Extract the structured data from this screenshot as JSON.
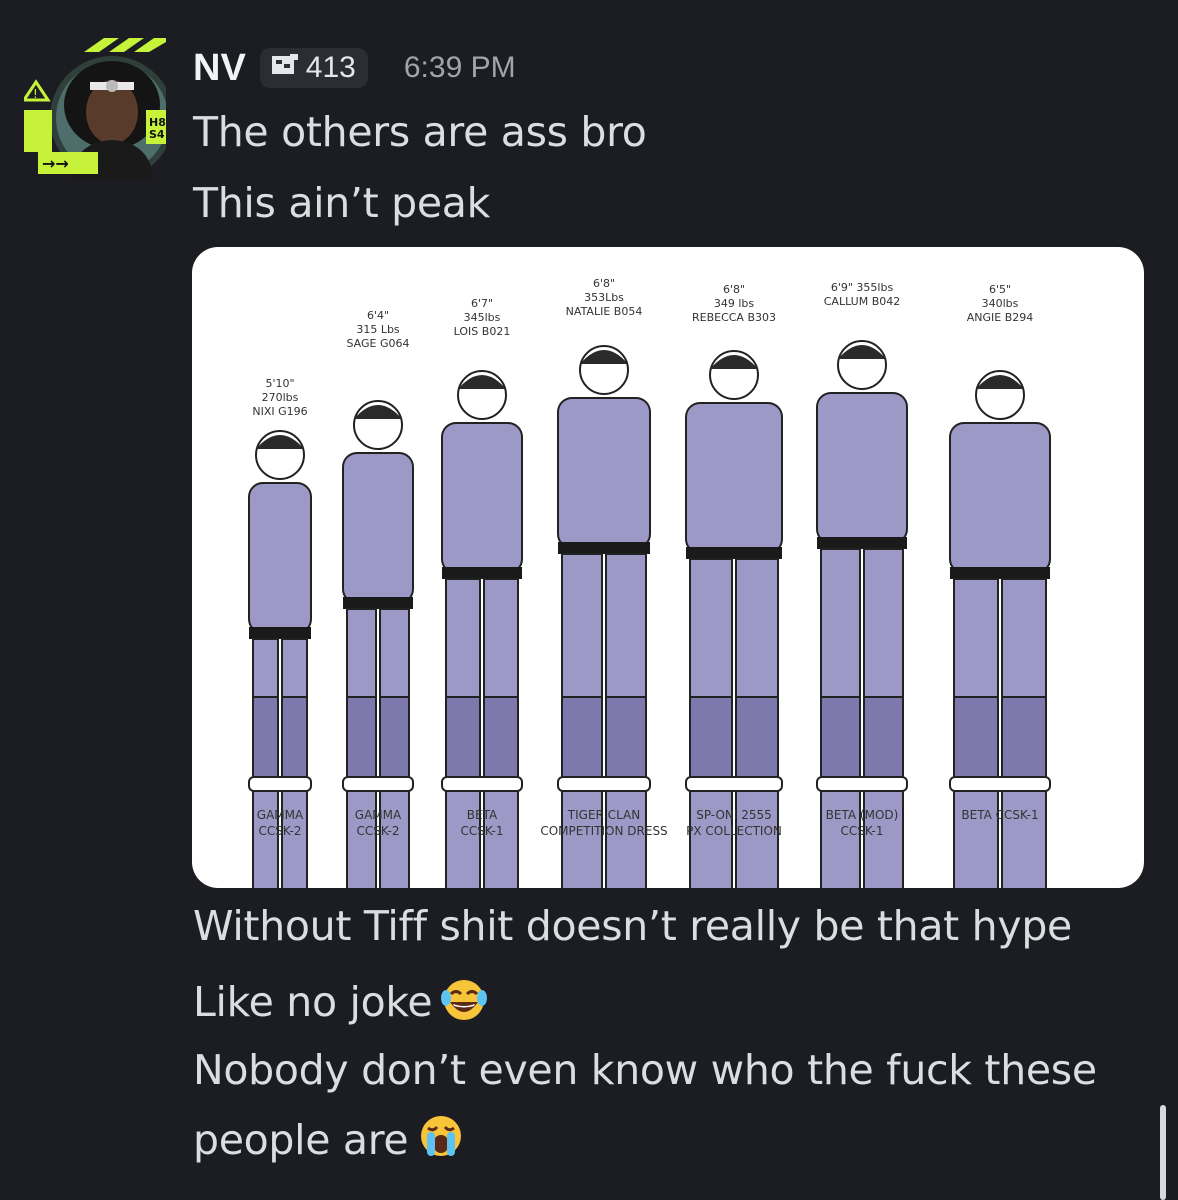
{
  "message": {
    "author": "NV",
    "tag_count": "413",
    "timestamp": "6:39 PM",
    "lines_before": [
      "The others are ass bro",
      "This ain’t peak"
    ],
    "lines_after": [
      "Without Tiff shit doesn’t really be that hype",
      "Like no joke",
      "Nobody don’t even know who the fuck these",
      "people are"
    ],
    "emoji_after_line_2": "joy-emoji",
    "emoji_after_line_4": "sob-emoji"
  },
  "avatar": {
    "badge_text": [
      "H8",
      "S4"
    ],
    "accent_color": "#c6f23a"
  },
  "attachment": {
    "characters": [
      {
        "stats": [
          "5'10\"",
          "270lbs",
          "NIXI G196"
        ],
        "outfit": [
          "GAMMA",
          "CCSK-2"
        ]
      },
      {
        "stats": [
          "6'4\"",
          "315 Lbs",
          "SAGE G064"
        ],
        "outfit": [
          "GAMMA",
          "CCSK-2"
        ]
      },
      {
        "stats": [
          "6'7\"",
          "345lbs",
          "LOIS B021"
        ],
        "outfit": [
          "BETA",
          "CCSK-1"
        ]
      },
      {
        "stats": [
          "6'8\"",
          "353Lbs",
          "NATALIE B054"
        ],
        "outfit": [
          "TIGER CLAN",
          "COMPETITION DRESS"
        ]
      },
      {
        "stats": [
          "6'8\"",
          "349 lbs",
          "REBECCA B303"
        ],
        "outfit": [
          "SP-ONI 2555",
          "PX COLLECTION"
        ]
      },
      {
        "stats": [
          "6'9\" 355lbs",
          "CALLUM B042"
        ],
        "outfit": [
          "BETA (MOD)",
          "CCSK-1"
        ]
      },
      {
        "stats": [
          "6'5\"",
          "340lbs",
          "ANGIE B294"
        ],
        "outfit": [
          "BETA CCSK-1"
        ]
      }
    ],
    "uniform_color": "#9d99c6"
  }
}
